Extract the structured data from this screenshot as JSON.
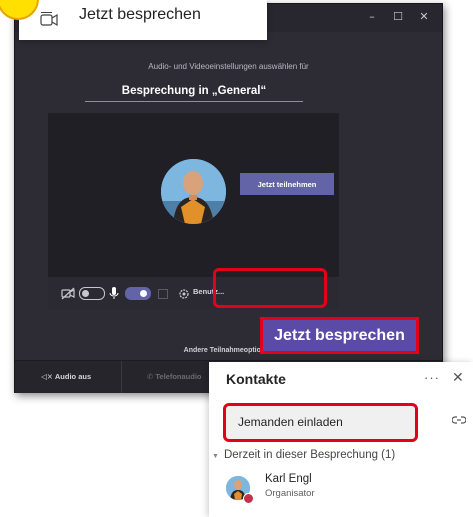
{
  "start_card": {
    "label": "Jetzt besprechen"
  },
  "meeting_window": {
    "controls": {
      "minimize": "–",
      "maximize": "☐",
      "close": "✕"
    },
    "setup_hint": "Audio- und Videoeinstellungen auswählen für",
    "meeting_name": "Besprechung in „General“",
    "toolbar": {
      "device_settings": "Benutz..."
    },
    "join_button": "Jetzt teilnehmen",
    "other_options": "Andere Teilnahmeoptionen",
    "bottom": {
      "audio_off": "Audio aus",
      "phone_audio": "Telefonaudio"
    }
  },
  "callout": {
    "label": "Jetzt besprechen"
  },
  "contacts": {
    "title": "Kontakte",
    "more": "···",
    "close": "✕",
    "invite_placeholder": "Jemanden einladen",
    "section": "Derzeit in dieser Besprechung (1)",
    "attendees": [
      {
        "name": "Karl Engl",
        "role": "Organisator"
      }
    ]
  },
  "colors": {
    "accent": "#6264a7",
    "highlight": "#e2001a",
    "window_bg": "#2d2c35",
    "callout_bg": "#5b4aa6"
  }
}
